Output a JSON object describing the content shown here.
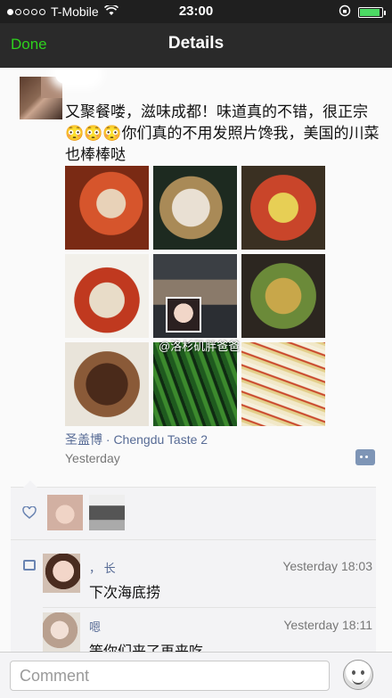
{
  "status_bar": {
    "carrier": "T-Mobile",
    "time": "23:00"
  },
  "nav": {
    "done_label": "Done",
    "title": "Details"
  },
  "post": {
    "text": "又聚餐喽，滋味成都！味道真的不错，很正宗😳😳😳你们真的不用发照片馋我，美国的川菜也棒棒哒",
    "photo_count": 9,
    "watermark": "@洛杉矶胖爸爸",
    "location": "圣盖博 · Chengdu Taste 2",
    "time": "Yesterday"
  },
  "likes": {
    "count_avatars": 2
  },
  "comments": [
    {
      "name": "，  长",
      "time": "Yesterday 18:03",
      "text": "下次海底捞"
    },
    {
      "name": "嗯",
      "time": "Yesterday 18:11",
      "text": "等你们来了再来吃"
    }
  ],
  "input": {
    "placeholder": "Comment"
  },
  "colors": {
    "accent_green": "#2ed11d",
    "link_blue": "#576b95"
  }
}
